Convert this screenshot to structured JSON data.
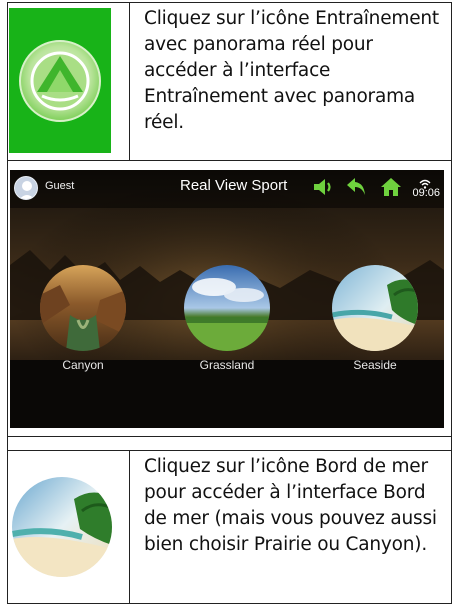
{
  "rows": [
    {
      "icon": "training-panorama-app-icon",
      "text": "Cliquez sur l’icône Entraînement avec panorama réel pour accéder à l’interface Entraînement avec panorama réel."
    },
    {
      "screen": {
        "user_label": "Guest",
        "title": "Real View Sport",
        "time": "09:06",
        "icons": [
          "volume-icon",
          "back-arrow-icon",
          "home-icon",
          "wifi-icon"
        ],
        "scenes": [
          {
            "label": "Canyon",
            "icon": "canyon-scene-icon"
          },
          {
            "label": "Grassland",
            "icon": "grassland-scene-icon"
          },
          {
            "label": "Seaside",
            "icon": "seaside-scene-icon"
          }
        ]
      }
    },
    {
      "icon": "seaside-scene-icon",
      "text": "Cliquez sur l’icône Bord de mer pour accéder à l’interface Bord de mer (mais vous pouvez aussi bien choisir Prairie ou Canyon)."
    }
  ],
  "colors": {
    "app_icon_bg": "#18b318",
    "accent_green": "#5fd03a",
    "screen_bg": "#0b0a08"
  }
}
